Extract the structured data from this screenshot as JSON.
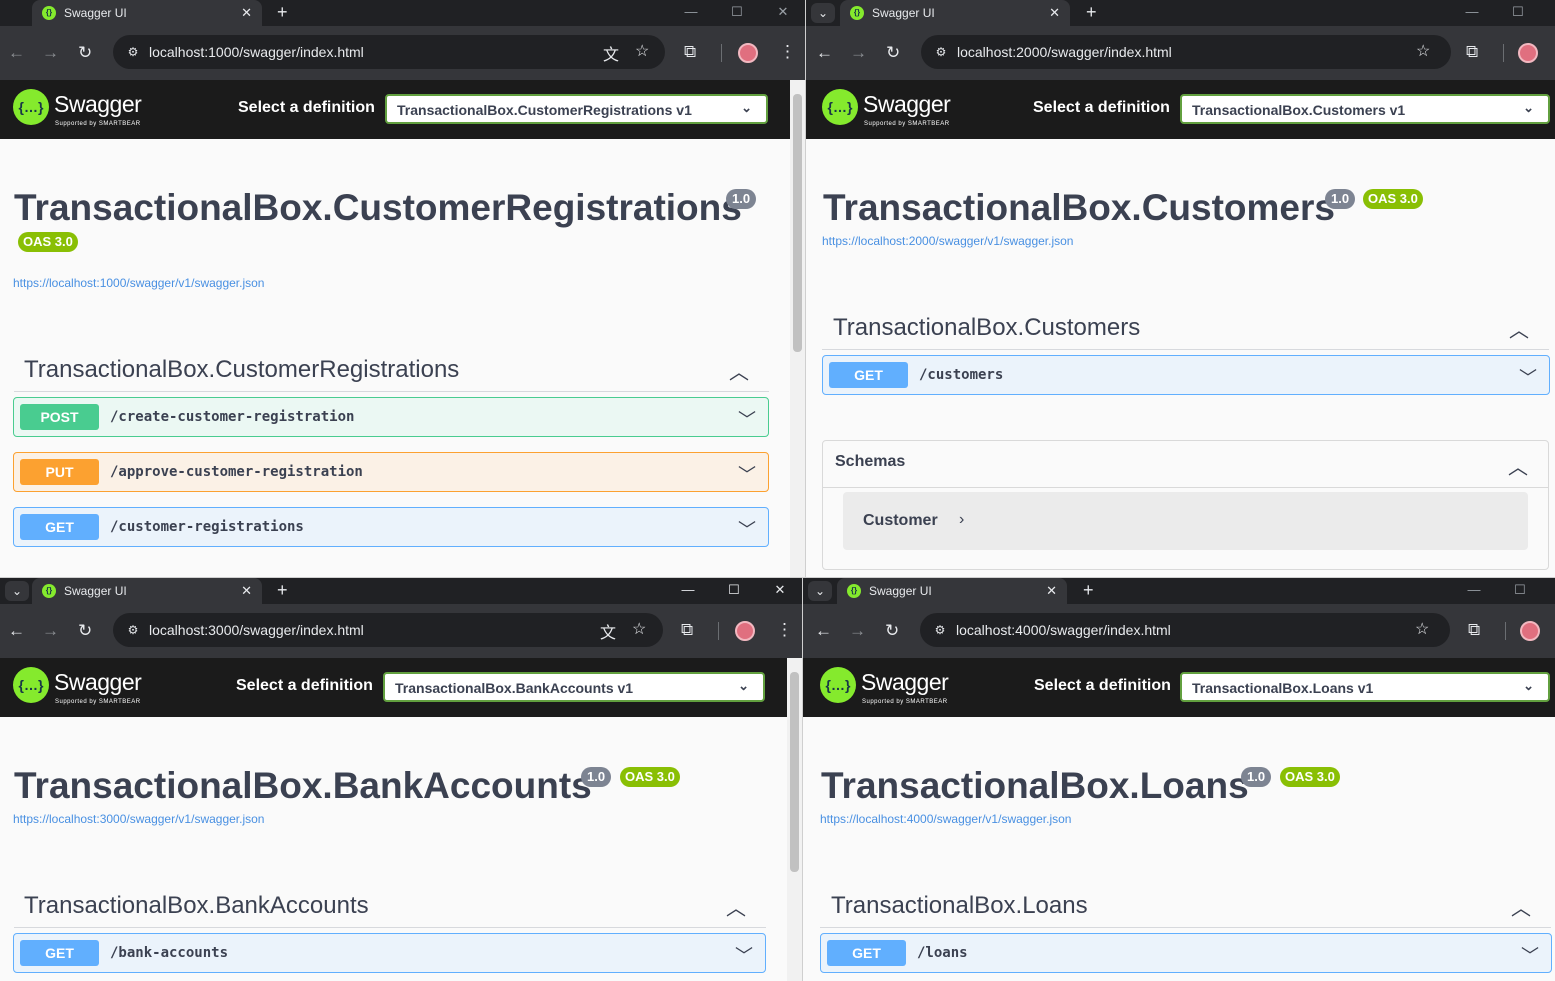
{
  "windows": [
    {
      "tab_title": "Swagger UI",
      "url": "localhost:1000/swagger/index.html",
      "select_label": "Select a definition",
      "definition": "TransactionalBox.CustomerRegistrations v1",
      "api_title": "TransactionalBox.CustomerRegistrations",
      "version": "1.0",
      "oas": "OAS 3.0",
      "spec_link": "https://localhost:1000/swagger/v1/swagger.json",
      "tag": "TransactionalBox.CustomerRegistrations",
      "ops": [
        {
          "method": "POST",
          "path": "/create-customer-registration"
        },
        {
          "method": "PUT",
          "path": "/approve-customer-registration"
        },
        {
          "method": "GET",
          "path": "/customer-registrations"
        }
      ]
    },
    {
      "tab_title": "Swagger UI",
      "url": "localhost:2000/swagger/index.html",
      "select_label": "Select a definition",
      "definition": "TransactionalBox.Customers v1",
      "api_title": "TransactionalBox.Customers",
      "version": "1.0",
      "oas": "OAS 3.0",
      "spec_link": "https://localhost:2000/swagger/v1/swagger.json",
      "tag": "TransactionalBox.Customers",
      "ops": [
        {
          "method": "GET",
          "path": "/customers"
        }
      ],
      "schemas_label": "Schemas",
      "schema_model": "Customer"
    },
    {
      "tab_title": "Swagger UI",
      "url": "localhost:3000/swagger/index.html",
      "select_label": "Select a definition",
      "definition": "TransactionalBox.BankAccounts v1",
      "api_title": "TransactionalBox.BankAccounts",
      "version": "1.0",
      "oas": "OAS 3.0",
      "spec_link": "https://localhost:3000/swagger/v1/swagger.json",
      "tag": "TransactionalBox.BankAccounts",
      "ops": [
        {
          "method": "GET",
          "path": "/bank-accounts"
        }
      ]
    },
    {
      "tab_title": "Swagger UI",
      "url": "localhost:4000/swagger/index.html",
      "select_label": "Select a definition",
      "definition": "TransactionalBox.Loans v1",
      "api_title": "TransactionalBox.Loans",
      "version": "1.0",
      "oas": "OAS 3.0",
      "spec_link": "https://localhost:4000/swagger/v1/swagger.json",
      "tag": "TransactionalBox.Loans",
      "ops": [
        {
          "method": "GET",
          "path": "/loans"
        }
      ]
    }
  ],
  "logo": {
    "name": "Swagger",
    "sub": "Supported by SMARTBEAR"
  },
  "colors": {
    "post": "#49cc90",
    "put": "#fca130",
    "get": "#61affe",
    "swagger_green": "#85ea2d",
    "oas_badge": "#89bf04"
  }
}
